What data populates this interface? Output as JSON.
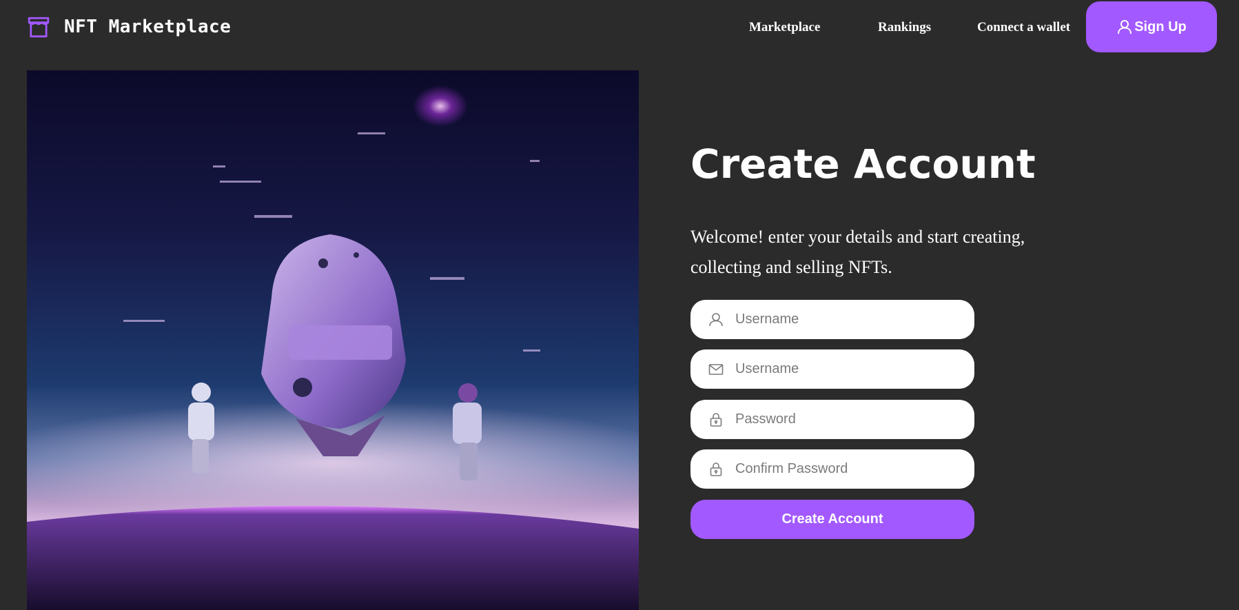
{
  "header": {
    "logo_text": "NFT Marketplace",
    "nav": [
      "Marketplace",
      "Rankings",
      "Connect a wallet"
    ],
    "signup_label": "Sign Up"
  },
  "form": {
    "title": "Create Account",
    "subtitle": "Welcome! enter your details and start creating, collecting and selling NFTs.",
    "fields": [
      {
        "placeholder": "Username",
        "icon": "user-icon"
      },
      {
        "placeholder": "Username",
        "icon": "mail-icon"
      },
      {
        "placeholder": "Password",
        "icon": "lock-icon"
      },
      {
        "placeholder": "Confirm Password",
        "icon": "lock-icon"
      }
    ],
    "submit_label": "Create Account"
  },
  "colors": {
    "background": "#2b2b2b",
    "accent": "#a259ff",
    "text": "#ffffff"
  }
}
